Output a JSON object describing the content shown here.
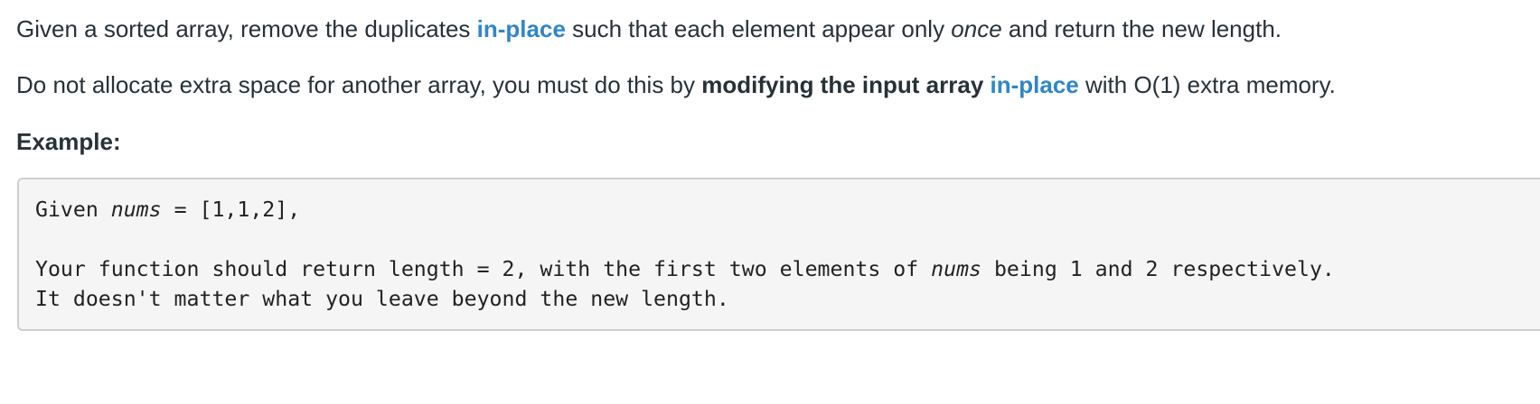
{
  "problem": {
    "para1": {
      "before_link": "Given a sorted array, remove the duplicates ",
      "link": "in-place",
      "middle": " such that each element appear only ",
      "emphasis": "once",
      "after": " and return the new length."
    },
    "para2": {
      "before_bold": "Do not allocate extra space for another array, you must do this by ",
      "bold": "modifying the input array",
      "space": " ",
      "link": "in-place",
      "after": " with O(1) extra memory."
    },
    "example_heading": "Example:"
  },
  "code_example": {
    "line1": {
      "prefix": "Given ",
      "var": "nums",
      "suffix": " = [1,1,2],"
    },
    "line2": {
      "prefix": "Your function should return length = 2, with the first two elements of ",
      "var": "nums",
      "suffix": " being 1 and 2 respectively."
    },
    "line3": "It doesn't matter what you leave beyond the new length."
  },
  "colors": {
    "text": "#263238",
    "link": "#2f86c8",
    "code_bg": "#f5f5f5",
    "code_border": "#cfcfcf"
  }
}
